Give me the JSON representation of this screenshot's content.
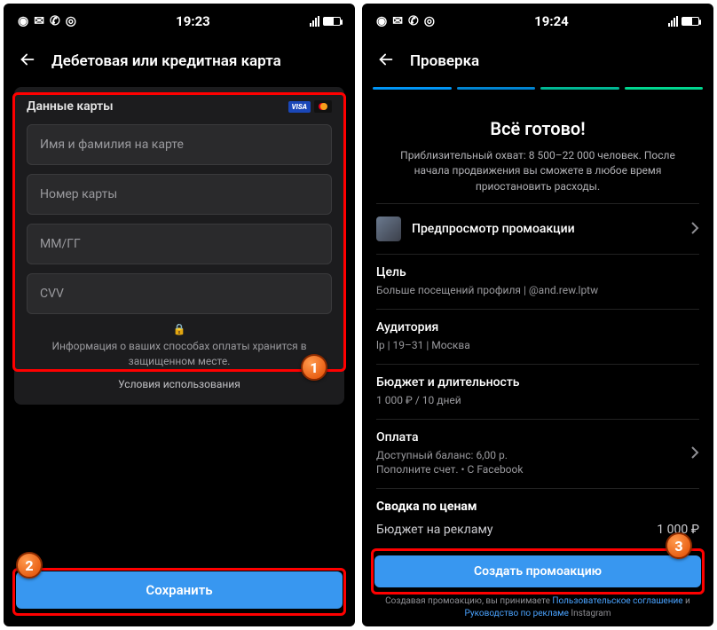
{
  "left": {
    "status": {
      "time": "19:23"
    },
    "header": {
      "title": "Дебетовая или кредитная карта"
    },
    "panel": {
      "title": "Данные карты",
      "fields": {
        "name": "Имя и фамилия на карте",
        "number": "Номер карты",
        "expiry": "ММ/ГГ",
        "cvv": "CVV"
      },
      "secure_note": "Информация о ваших способах оплаты хранится в защищенном месте.",
      "terms_label": "Условия использования"
    },
    "primary_button": "Сохранить",
    "badges": {
      "panel": "1",
      "button": "2"
    }
  },
  "right": {
    "status": {
      "time": "19:24"
    },
    "header": {
      "title": "Проверка"
    },
    "progress_colors": [
      "#0095f6",
      "#0084d1",
      "#00b894",
      "#00d68f"
    ],
    "hero": {
      "title": "Всё готово!",
      "subtitle": "Приблизительный охват: 8 500–22 000 человек. После начала продвижения вы сможете в любое время приостановить расходы."
    },
    "preview_label": "Предпросмотр промоакции",
    "goal": {
      "hd": "Цель",
      "sb": "Больше посещений профиля | @and.rew.lptw"
    },
    "audience": {
      "hd": "Аудитория",
      "sb": "lp | 19–31 | Москва"
    },
    "budget": {
      "hd": "Бюджет и длительность",
      "sb": "1 000 ₽ / 10 дней"
    },
    "payment": {
      "hd": "Оплата",
      "sb1": "Доступный баланс: 6,00 р.",
      "sb2": "Пополните счет. • С Facebook"
    },
    "price_summary": {
      "title": "Сводка по ценам",
      "row_label": "Бюджет на рекламу",
      "row_value": "1 000 ₽"
    },
    "primary_button": "Создать промоакцию",
    "disclaimer": {
      "pre": "Создавая промоакцию, вы принимаете ",
      "link1": "Пользовательское соглашение",
      "mid": " и ",
      "link2": "Руководство по рекламе",
      "post": " Instagram"
    },
    "badges": {
      "button": "3"
    }
  }
}
